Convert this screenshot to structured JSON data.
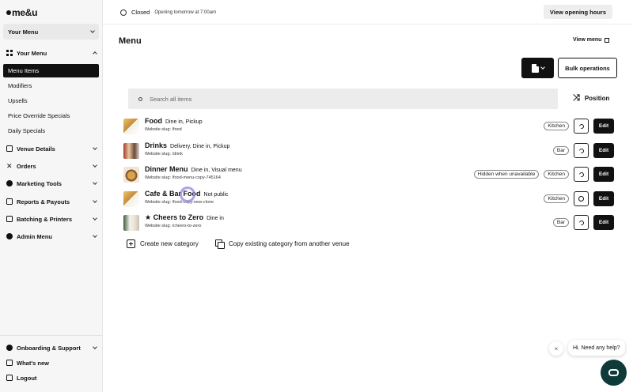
{
  "brand": "me&u",
  "sidebar": {
    "menu_select": "Your Menu",
    "your_menu_group": "Your Menu",
    "sub_items": [
      "Menu Items",
      "Modifiers",
      "Upsells",
      "Price Override Specials",
      "Daily Specials"
    ],
    "groups": [
      "Venue Details",
      "Orders",
      "Marketing Tools",
      "Reports & Payouts",
      "Batching & Printers",
      "Admin Menu"
    ],
    "footer": [
      "Onboarding & Support",
      "What's new",
      "Logout"
    ]
  },
  "topbar": {
    "status": "Closed",
    "status_sub": "Opening tomorrow at 7:00am",
    "hours_button": "View opening hours"
  },
  "main": {
    "title": "Menu",
    "view_menu": "View menu",
    "bulk_button": "Bulk operations",
    "search_placeholder": "Search all items",
    "position": "Position",
    "create_category": "Create new category",
    "copy_category": "Copy existing category from another venue"
  },
  "rows": [
    {
      "name": "Food",
      "tags": "Dine in, Pickup",
      "slug": "Website slug: /food",
      "hidden": "",
      "station": "Kitchen",
      "action_icon": "moon-icon",
      "edit": "Edit"
    },
    {
      "name": "Drinks",
      "tags": "Delivery, Dine in, Pickup",
      "slug": "Website slug: /drink",
      "hidden": "",
      "station": "Bar",
      "action_icon": "moon-icon",
      "edit": "Edit"
    },
    {
      "name": "Dinner Menu",
      "tags": "Dine in, Visual menu",
      "slug": "Website slug: /food-menu-copy-745164",
      "hidden": "Hidden when unavailable",
      "station": "Kitchen",
      "action_icon": "moon-icon",
      "edit": "Edit"
    },
    {
      "name": "Cafe & Bar Food",
      "tags": "Not public",
      "slug": "Website slug: /food-copy-new-clone",
      "hidden": "",
      "station": "Kitchen",
      "action_icon": "clock-icon",
      "edit": "Edit"
    },
    {
      "name": "★ Cheers to Zero",
      "tags": "Dine in",
      "slug": "Website slug: /cheers-to-zero",
      "hidden": "",
      "station": "Bar",
      "action_icon": "moon-icon",
      "edit": "Edit"
    }
  ],
  "chat": {
    "bubble": "Hi. Need any help?",
    "close": "×"
  },
  "colors": {
    "primary": "#111111",
    "sidebar_bg": "#f6f6f6",
    "chat_button": "#0e3a3a",
    "cursor_ring": "#8f86e6"
  }
}
